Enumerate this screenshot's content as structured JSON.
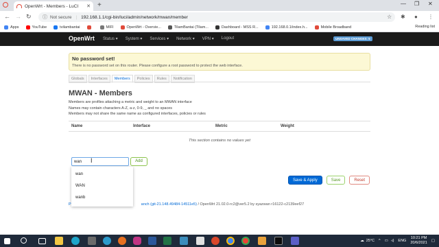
{
  "browser": {
    "tab_title": "OpenWrt - Members - LuCI",
    "new_tab": "+",
    "not_secure": "Not secure",
    "url": "192.168.1.1/cgi-bin/luci/admin/network/mwan/member",
    "reading_list": "Reading list",
    "bookmarks": [
      {
        "label": "Apps",
        "color": "#4285f4"
      },
      {
        "label": "YouTube",
        "color": "#ff0000"
      },
      {
        "label": "tvilambantai",
        "color": "#1877f2"
      },
      {
        "label": "",
        "color": "#e04a3a"
      },
      {
        "label": "MIFI",
        "color": "#777777"
      },
      {
        "label": "OpenWrt - Overvie...",
        "color": "#e04a3a"
      },
      {
        "label": "TilamBantai (Tilam...",
        "color": "#555555"
      },
      {
        "label": "Dashboard - MSS R...",
        "color": "#333333"
      },
      {
        "label": "192.168.0.1/index.h...",
        "color": "#4285f4"
      },
      {
        "label": "Mobile Broadband",
        "color": "#e04a3a"
      }
    ]
  },
  "luci": {
    "brand": "OpenWrt",
    "nav": [
      "Status ▾",
      "System ▾",
      "Services ▾",
      "Network ▾",
      "VPN ▾",
      "Logout"
    ],
    "unsaved_badge": "UNSAVED CHANGES: 5",
    "alert_title": "No password set!",
    "alert_text": "There is no password set on this router. Please configure a root password to protect the web interface.",
    "tabs": [
      "Globals",
      "Interfaces",
      "Members",
      "Policies",
      "Rules",
      "Notification"
    ],
    "active_tab": "Members",
    "page_title": "MWAN - Members",
    "desc": [
      "Members are profiles attaching a metric and weight to an MWAN interface",
      "Names may contain characters A-Z, a-z, 0-9, _ and no spaces",
      "Members may not share the same name as configured interfaces, policies or rules"
    ],
    "columns": [
      "Name",
      "Interface",
      "Metric",
      "Weight"
    ],
    "empty_text": "This section contains no values yet",
    "input_value": "wan",
    "add_label": "Add",
    "suggestions": [
      "wan",
      "WAN",
      "wanb"
    ],
    "save_apply": "Save & Apply",
    "save": "Save",
    "reset": "Reset",
    "footer_prefix": "P",
    "footer_link": "anch (git-21.148.49484-14511e5)",
    "footer_rest": " / OpenWrt 21.02.0-rc2@ver5.2 by syazwan r16122-c2139eef27"
  },
  "taskbar": {
    "temperature": "25°C",
    "language": "ENG",
    "time": "10:21 PM",
    "date": "20/6/2021"
  }
}
